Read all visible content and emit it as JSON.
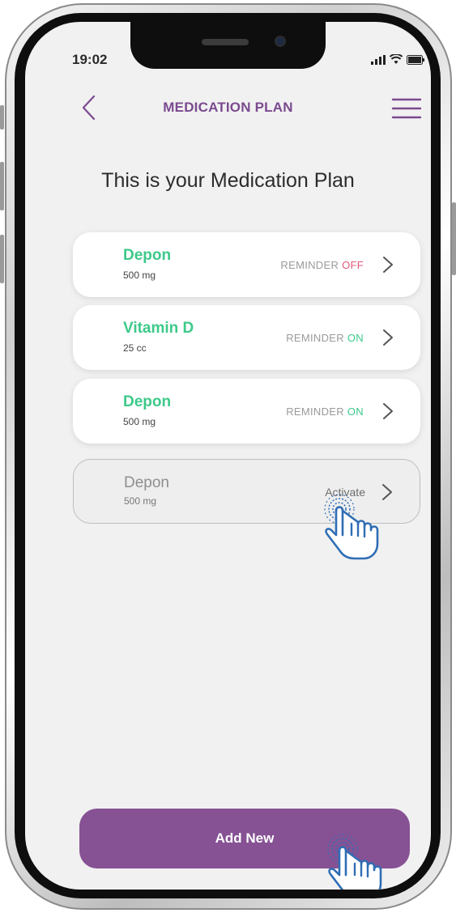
{
  "status_bar": {
    "time": "19:02",
    "icons": [
      "signal-icon",
      "wifi-icon",
      "battery-icon"
    ]
  },
  "header": {
    "title": "MEDICATION PLAN",
    "back_icon": "chevron-left-icon",
    "menu_icon": "hamburger-menu-icon"
  },
  "page": {
    "heading": "This is your Medication Plan"
  },
  "medications": [
    {
      "name": "Depon",
      "dose": "500 mg",
      "reminder_label": "REMINDER",
      "reminder_state": "OFF"
    },
    {
      "name": "Vitamin D",
      "dose": "25 cc",
      "reminder_label": "REMINDER",
      "reminder_state": "ON"
    },
    {
      "name": "Depon",
      "dose": "500 mg",
      "reminder_label": "REMINDER",
      "reminder_state": "ON"
    },
    {
      "name": "Depon",
      "dose": "500 mg",
      "action_label": "Activate"
    }
  ],
  "add_button": {
    "label": "Add New"
  },
  "colors": {
    "accent_purple": "#865294",
    "title_purple": "#7a4a8f",
    "green": "#3dc98a",
    "pink_off": "#e0577a",
    "hand_blue": "#2f6db5"
  }
}
